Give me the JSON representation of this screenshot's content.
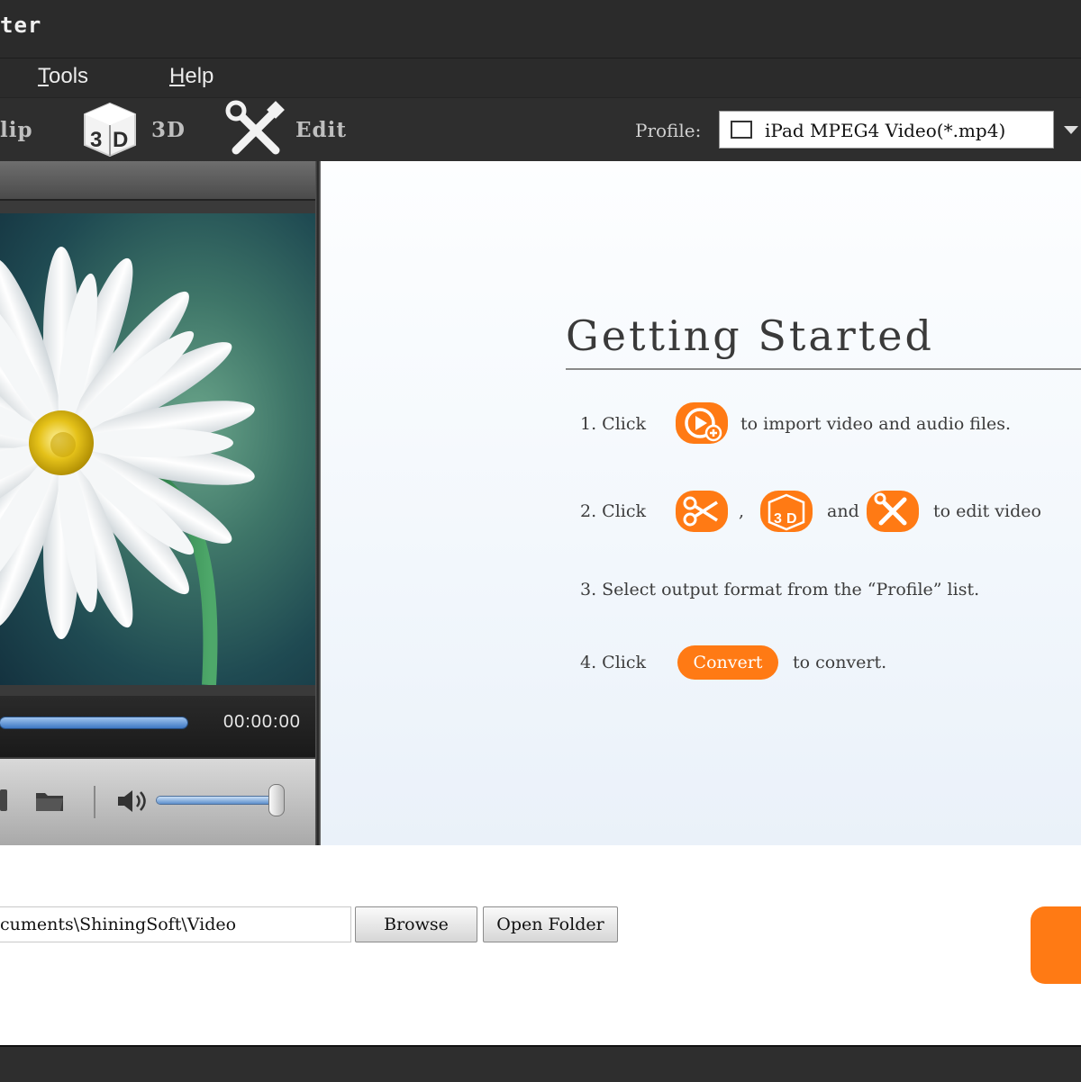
{
  "window": {
    "title": "ter"
  },
  "menu": [
    {
      "label": "Tools",
      "mnemonic": "T",
      "rest": "ools"
    },
    {
      "label": "Help",
      "mnemonic": "H",
      "rest": "elp"
    }
  ],
  "toolbar": {
    "clip_label": "lip",
    "threed_label": "3D",
    "edit_label": "Edit",
    "profile_label": "Profile:",
    "profile_value": "iPad MPEG4 Video(*.mp4)"
  },
  "player": {
    "time": "00:00:00",
    "progress_fraction": 0.6
  },
  "getting_started": {
    "title": "Getting Started",
    "step1": {
      "prefix": "1. Click",
      "suffix": "to import video and audio files."
    },
    "step2": {
      "prefix": "2. Click",
      "comma": ",",
      "and": "and",
      "suffix": "to edit video"
    },
    "step3": {
      "text": "3. Select output format from the “Profile” list."
    },
    "step4": {
      "prefix": "4. Click",
      "button": "Convert",
      "suffix": "to convert."
    }
  },
  "output": {
    "path": "cuments\\ShiningSoft\\Video",
    "browse_label": "Browse",
    "open_folder_label": "Open Folder"
  },
  "colors": {
    "accent": "#ff7a14",
    "dark_chrome": "#2b2b2b",
    "panel_bg": "#f2f7fc"
  }
}
